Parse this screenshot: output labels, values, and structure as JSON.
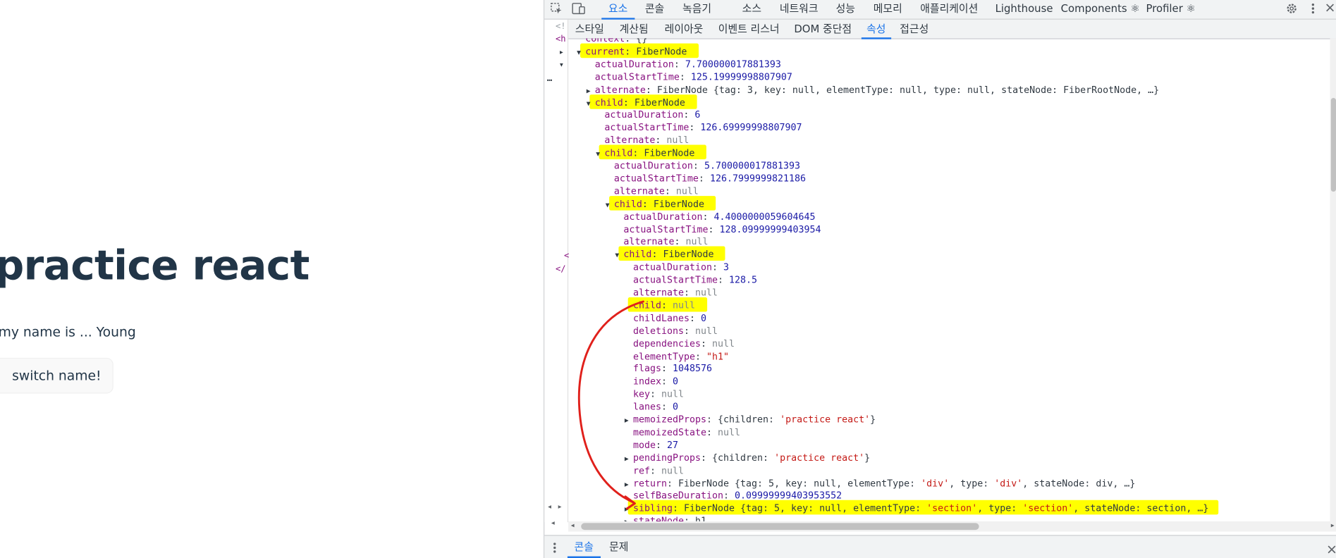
{
  "page": {
    "title": "practice react",
    "subtitle": "my name is ... Young",
    "button_label": "switch name!"
  },
  "devtools": {
    "main_tabs": [
      "요소",
      "콘솔",
      "녹음기",
      "소스",
      "네트워크",
      "성능",
      "메모리",
      "애플리케이션",
      "Lighthouse",
      "Components ⚛",
      "Profiler ⚛"
    ],
    "active_main_tab": "요소",
    "sub_tabs": [
      "스타일",
      "계산됨",
      "레이아웃",
      "이벤트 리스너",
      "DOM 중단점",
      "속성",
      "접근성"
    ],
    "active_sub_tab": "속성",
    "drawer_tabs": [
      "콘솔",
      "문제"
    ],
    "active_drawer_tab": "콘솔",
    "gutter_text": [
      "<!",
      "<h",
      "<",
      "</"
    ],
    "tree_rows": [
      {
        "key": "context",
        "value": "{}",
        "kind": "obj",
        "depth": 0,
        "cut": true
      },
      {
        "key": "current",
        "value": "FiberNode",
        "kind": "obj",
        "depth": 0,
        "open": true,
        "highlight": true
      },
      {
        "key": "actualDuration",
        "value": "7.700000017881393",
        "kind": "num",
        "depth": 1
      },
      {
        "key": "actualStartTime",
        "value": "125.19999998807907",
        "kind": "num",
        "depth": 1
      },
      {
        "key": "alternate",
        "value": "FiberNode {tag: 3, key: null, elementType: null, type: null, stateNode: FiberRootNode, …}",
        "kind": "obj",
        "depth": 1,
        "closed": true
      },
      {
        "key": "child",
        "value": "FiberNode",
        "kind": "obj",
        "depth": 1,
        "open": true,
        "highlight": true
      },
      {
        "key": "actualDuration",
        "value": "6",
        "kind": "num",
        "depth": 2
      },
      {
        "key": "actualStartTime",
        "value": "126.69999998807907",
        "kind": "num",
        "depth": 2
      },
      {
        "key": "alternate",
        "value": "null",
        "kind": "null",
        "depth": 2
      },
      {
        "key": "child",
        "value": "FiberNode",
        "kind": "obj",
        "depth": 2,
        "open": true,
        "highlight": true
      },
      {
        "key": "actualDuration",
        "value": "5.700000017881393",
        "kind": "num",
        "depth": 3
      },
      {
        "key": "actualStartTime",
        "value": "126.7999999821186",
        "kind": "num",
        "depth": 3
      },
      {
        "key": "alternate",
        "value": "null",
        "kind": "null",
        "depth": 3
      },
      {
        "key": "child",
        "value": "FiberNode",
        "kind": "obj",
        "depth": 3,
        "open": true,
        "highlight": true
      },
      {
        "key": "actualDuration",
        "value": "4.4000000059604645",
        "kind": "num",
        "depth": 4
      },
      {
        "key": "actualStartTime",
        "value": "128.09999999403954",
        "kind": "num",
        "depth": 4
      },
      {
        "key": "alternate",
        "value": "null",
        "kind": "null",
        "depth": 4
      },
      {
        "key": "child",
        "value": "FiberNode",
        "kind": "obj",
        "depth": 4,
        "open": true,
        "highlight": true
      },
      {
        "key": "actualDuration",
        "value": "3",
        "kind": "num",
        "depth": 5
      },
      {
        "key": "actualStartTime",
        "value": "128.5",
        "kind": "num",
        "depth": 5
      },
      {
        "key": "alternate",
        "value": "null",
        "kind": "null",
        "depth": 5
      },
      {
        "key": "child",
        "value": "null",
        "kind": "null",
        "depth": 5,
        "highlight": true
      },
      {
        "key": "childLanes",
        "value": "0",
        "kind": "num",
        "depth": 5
      },
      {
        "key": "deletions",
        "value": "null",
        "kind": "null",
        "depth": 5
      },
      {
        "key": "dependencies",
        "value": "null",
        "kind": "null",
        "depth": 5
      },
      {
        "key": "elementType",
        "value": "\"h1\"",
        "kind": "str",
        "depth": 5
      },
      {
        "key": "flags",
        "value": "1048576",
        "kind": "num",
        "depth": 5
      },
      {
        "key": "index",
        "value": "0",
        "kind": "num",
        "depth": 5
      },
      {
        "key": "key",
        "value": "null",
        "kind": "null",
        "depth": 5
      },
      {
        "key": "lanes",
        "value": "0",
        "kind": "num",
        "depth": 5
      },
      {
        "key": "memoizedProps",
        "value": "{children: 'practice react'}",
        "kind": "objstr",
        "depth": 5,
        "closed": true
      },
      {
        "key": "memoizedState",
        "value": "null",
        "kind": "null",
        "depth": 5
      },
      {
        "key": "mode",
        "value": "27",
        "kind": "num",
        "depth": 5
      },
      {
        "key": "pendingProps",
        "value": "{children: 'practice react'}",
        "kind": "objstr",
        "depth": 5,
        "closed": true
      },
      {
        "key": "ref",
        "value": "null",
        "kind": "null",
        "depth": 5
      },
      {
        "key": "return",
        "value": "FiberNode {tag: 5, key: null, elementType: 'div', type: 'div', stateNode: div, …}",
        "kind": "objstr",
        "depth": 5,
        "closed": true
      },
      {
        "key": "selfBaseDuration",
        "value": "0.09999999403953552",
        "kind": "num",
        "depth": 5
      },
      {
        "key": "sibling",
        "value": "FiberNode {tag: 5, key: null, elementType: 'section', type: 'section', stateNode: section, …}",
        "kind": "objstr",
        "depth": 5,
        "closed": true,
        "highlight": true
      },
      {
        "key": "stateNode",
        "value": "h1",
        "kind": "obj",
        "depth": 5,
        "closed": true,
        "cut": true
      }
    ]
  },
  "colors": {
    "highlight": "#ffff00",
    "annotation_arrow": "#e0201b",
    "accent": "#1a73e8",
    "key": "#881280",
    "number": "#1a1aa6",
    "string": "#c41a16"
  }
}
